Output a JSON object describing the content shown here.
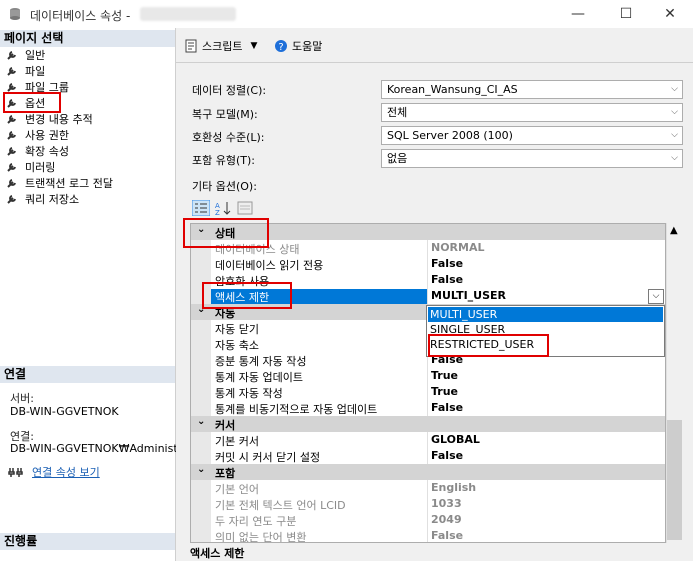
{
  "window": {
    "title": "데이터베이스 속성 -",
    "minimize": "—",
    "maximize": "☐",
    "close": "✕"
  },
  "left": {
    "page_select_header": "페이지 선택",
    "pages": [
      "일반",
      "파일",
      "파일 그룹",
      "옵션",
      "변경 내용 추적",
      "사용 권한",
      "확장 속성",
      "미러링",
      "트랜잭션 로그 전달",
      "쿼리 저장소"
    ],
    "connection_header": "연결",
    "server_label": "서버:",
    "server_value": "DB-WIN-GGVETNOK",
    "connection_label": "연결:",
    "connection_value": "DB-WIN-GGVETNOK₩Administra",
    "view_conn_props": "연결 속성 보기",
    "progress_header": "진행률"
  },
  "toolbar": {
    "script": "스크립트",
    "help": "도움말"
  },
  "fields": {
    "collation_label": "데이터 정렬(C):",
    "collation_value": "Korean_Wansung_CI_AS",
    "recovery_label": "복구 모델(M):",
    "recovery_value": "전체",
    "compat_label": "호환성 수준(L):",
    "compat_value": "SQL Server 2008 (100)",
    "containment_label": "포함 유형(T):",
    "containment_value": "없음",
    "other_label": "기타 옵션(O):"
  },
  "grid": {
    "rows": [
      {
        "type": "cat",
        "name": "상태"
      },
      {
        "type": "dim",
        "name": "데이터베이스 상태",
        "value": "NORMAL"
      },
      {
        "type": "prop",
        "name": "데이터베이스 읽기 전용",
        "value": "False"
      },
      {
        "type": "prop",
        "name": "암호화 사용",
        "value": "False"
      },
      {
        "type": "sel",
        "name": "액세스 제한",
        "value": "MULTI_USER"
      },
      {
        "type": "cat",
        "name": "자동"
      },
      {
        "type": "prop",
        "name": "자동 닫기",
        "value": ""
      },
      {
        "type": "prop",
        "name": "자동 축소",
        "value": ""
      },
      {
        "type": "prop",
        "name": "증분 통계 자동 작성",
        "value": "False"
      },
      {
        "type": "prop",
        "name": "통계 자동 업데이트",
        "value": "True"
      },
      {
        "type": "prop",
        "name": "통계 자동 작성",
        "value": "True"
      },
      {
        "type": "prop",
        "name": "통계를 비동기적으로 자동 업데이트",
        "value": "False"
      },
      {
        "type": "cat",
        "name": "커서"
      },
      {
        "type": "prop",
        "name": "기본 커서",
        "value": "GLOBAL"
      },
      {
        "type": "prop",
        "name": "커밋 시 커서 닫기 설정",
        "value": "False"
      },
      {
        "type": "cat",
        "name": "포함"
      },
      {
        "type": "dim",
        "name": "기본 언어",
        "value": "English"
      },
      {
        "type": "dim",
        "name": "기본 전체 텍스트 언어 LCID",
        "value": "1033"
      },
      {
        "type": "dim",
        "name": "두 자리 연도 구분",
        "value": "2049"
      },
      {
        "type": "dim",
        "name": "의미 없는 단어 변환",
        "value": "False"
      }
    ],
    "dropdown": [
      "MULTI_USER",
      "SINGLE_USER",
      "RESTRICTED_USER"
    ],
    "description_title": "액세스 제한"
  }
}
